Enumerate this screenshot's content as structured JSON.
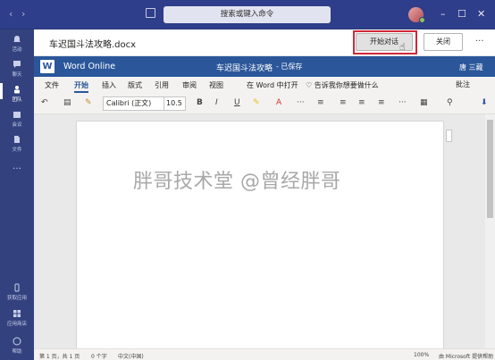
{
  "titlebar": {
    "back": "‹",
    "forward": "›",
    "search_placeholder": "搜索或键入命令",
    "minimize": "–",
    "maximize": "☐",
    "close": "✕"
  },
  "rail": [
    {
      "label": "活动",
      "icon": "bell-icon"
    },
    {
      "label": "聊天",
      "icon": "chat-icon"
    },
    {
      "label": "团队",
      "icon": "teams-icon",
      "active": true
    },
    {
      "label": "会议",
      "icon": "calendar-icon"
    },
    {
      "label": "文件",
      "icon": "file-icon"
    },
    {
      "label": "…",
      "icon": "more-icon"
    },
    {
      "label": "获取应用",
      "icon": "phone-icon"
    },
    {
      "label": "应用商店",
      "icon": "store-icon"
    },
    {
      "label": "帮助",
      "icon": "help-icon"
    }
  ],
  "file": {
    "name": "车迟国斗法攻略.docx",
    "start_chat": "开始对话",
    "close": "关闭",
    "more": "···"
  },
  "word": {
    "logo": "W",
    "app": "Word Online",
    "doc": "车迟国斗法攻略",
    "saved": "- 已保存",
    "user": "唐 三藏"
  },
  "tabs": [
    {
      "label": "文件"
    },
    {
      "label": "开始",
      "active": true
    },
    {
      "label": "插入"
    },
    {
      "label": "版式"
    },
    {
      "label": "引用"
    },
    {
      "label": "审阅"
    },
    {
      "label": "视图"
    },
    {
      "label": "在 Word 中打开"
    },
    {
      "label": "♡ 告诉我你想要做什么"
    }
  ],
  "comment": "批注",
  "toolbar": {
    "font": "Calibri (正文)",
    "size": "10.5",
    "bold": "B",
    "italic": "I",
    "underline": "U"
  },
  "watermark": "胖哥技术堂 @曾经胖哥",
  "status": {
    "page": "第 1 页，共 1 页",
    "words": "0 个字",
    "lang": "中文(中国)",
    "zoom": "100%",
    "provider": "由 Microsoft 提供帮助"
  }
}
